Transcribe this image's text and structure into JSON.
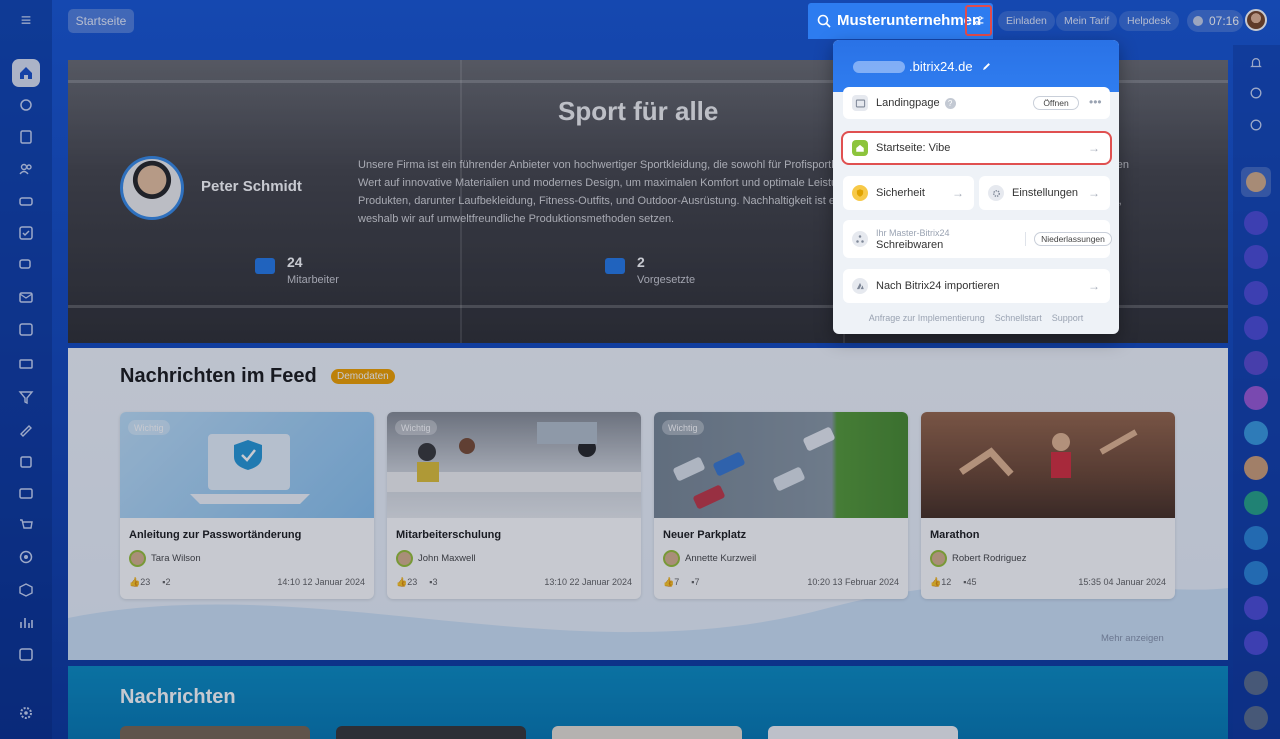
{
  "header": {
    "startseite_label": "Startseite",
    "company_name": "Musterunternehmen",
    "invite_label": "Einladen",
    "plan_label": "Mein Tarif",
    "helpdesk_label": "Helpdesk",
    "time": "07:16"
  },
  "hero": {
    "title": "Sport für alle",
    "description": "Unsere Firma ist ein führender Anbieter von hochwertiger Sportkleidung, die sowohl für Profisportler als auch für Freizeitsportler geeignet ist. Wir legen großen Wert auf innovative Materialien und modernes Design, um maximalen Komfort und optimale Leistung zu gewährleisten. Wir bieten eine breite Palette an Produkten, darunter Laufbekleidung, Fitness-Outfits, und Outdoor-Ausrüstung. Nachhaltigkeit ist ein wichtiger Bestandteil unserer Unternehmensphilosophie, weshalb wir auf umweltfreundliche Produktionsmethoden setzen.",
    "person_name": "Peter Schmidt",
    "stats": [
      {
        "value": "24",
        "label": "Mitarbeiter"
      },
      {
        "value": "2",
        "label": "Vorgesetzte"
      }
    ]
  },
  "feed": {
    "title": "Nachrichten im Feed",
    "badge": "Demodaten",
    "more_label": "Mehr anzeigen",
    "cards": [
      {
        "tag": "Wichtig",
        "title": "Anleitung zur Passwortänderung",
        "author": "Tara Wilson",
        "likes": "23",
        "comments": "2",
        "date": "14:10 12 Januar 2024"
      },
      {
        "tag": "Wichtig",
        "title": "Mitarbeiterschulung",
        "author": "John Maxwell",
        "likes": "23",
        "comments": "3",
        "date": "13:10 22 Januar 2024"
      },
      {
        "tag": "Wichtig",
        "title": "Neuer Parkplatz",
        "author": "Annette Kurzweil",
        "likes": "7",
        "comments": "7",
        "date": "10:20 13 Februar 2024"
      },
      {
        "tag": "",
        "title": "Marathon",
        "author": "Robert Rodriguez",
        "likes": "12",
        "comments": "45",
        "date": "15:35 04 Januar 2024"
      }
    ]
  },
  "news": {
    "title": "Nachrichten"
  },
  "popup": {
    "domain_suffix": ".bitrix24.de",
    "landingpage_label": "Landingpage",
    "open_label": "Öffnen",
    "startseite_label": "Startseite: Vibe",
    "security_label": "Sicherheit",
    "settings_label": "Einstellungen",
    "master_caption": "Ihr Master-Bitrix24",
    "master_name": "Schreibwaren",
    "branches_label": "Niederlassungen",
    "import_label": "Nach Bitrix24 importieren",
    "footer_links": [
      "Anfrage zur Implementierung",
      "Schnellstart",
      "Support"
    ]
  },
  "colors": {
    "accent": "#2f7df0",
    "badge": "#f2a300",
    "highlight": "#e05050"
  }
}
